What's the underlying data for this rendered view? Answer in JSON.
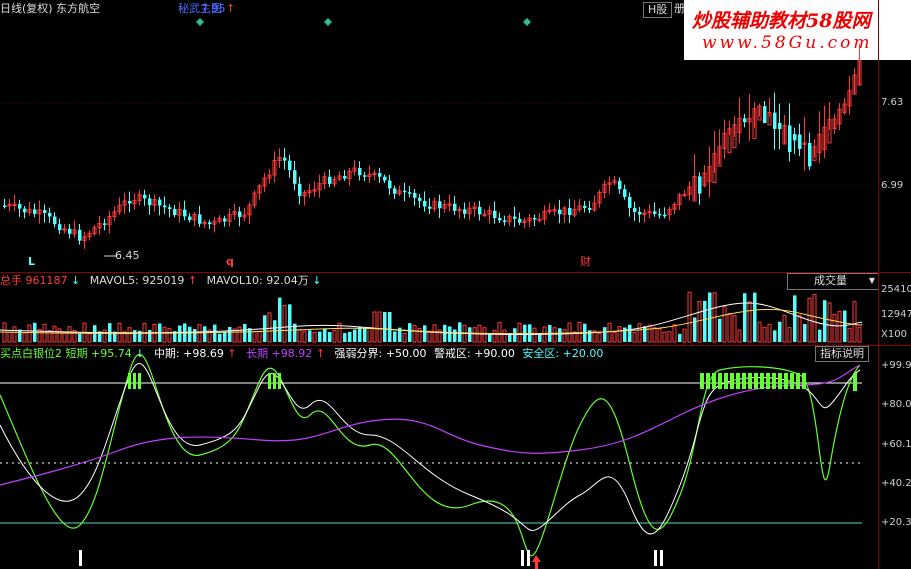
{
  "header": {
    "title": "日线(复权) 东方航空",
    "indicator_label": "秘武主图",
    "indicator_value": "7.95",
    "indicator_arrow": "↑",
    "hshare_button": "H股",
    "hshare_extra": "册"
  },
  "watermark": {
    "line1": "炒股辅助教材58股网",
    "line2": "www.58Gu.com"
  },
  "price_chart": {
    "y_ticks": [
      "7.63",
      "6.99"
    ],
    "low_marker": "6.45",
    "marker_l": "L",
    "marker_q": "q",
    "marker_cai": "财"
  },
  "volume_panel": {
    "label_prefix": "总手",
    "total_value": "961187",
    "total_arrow": "↓",
    "mavol5_label": "MAVOL5:",
    "mavol5_value": "925019",
    "mavol5_arrow": "↑",
    "mavol10_label": "MAVOL10:",
    "mavol10_value": "92.04万",
    "mavol10_arrow": "↓",
    "dropdown_label": "成交量",
    "dropdown_icon": "▼",
    "y_ticks": [
      "25410",
      "12947",
      "X100"
    ]
  },
  "indicator_panel": {
    "name": "买点白银位2",
    "short_label": "短期",
    "short_value": "+95.74",
    "short_arrow": "↓",
    "mid_label": "中期:",
    "mid_value": "+98.69",
    "mid_arrow": "↑",
    "long_label": "长期",
    "long_value": "+98.92",
    "long_arrow": "↑",
    "strong_label": "强弱分界:",
    "strong_value": "+50.00",
    "warn_label": "警戒区:",
    "warn_value": "+90.00",
    "safe_label": "安全区:",
    "safe_value": "+20.00",
    "help_button": "指标说明",
    "y_ticks": [
      "+99.9",
      "+80.0",
      "+60.1",
      "+40.2",
      "+20.3"
    ]
  },
  "colors": {
    "up": "#ff3a3a",
    "down": "#54ffff",
    "grid": "#8b0000",
    "short_line": "#66ff33",
    "mid_line": "#ffffff",
    "long_line": "#c040ff"
  }
}
